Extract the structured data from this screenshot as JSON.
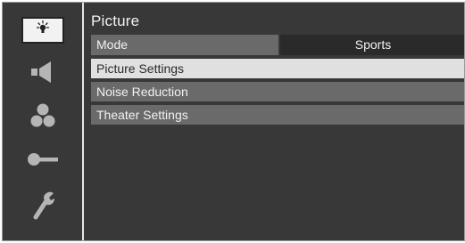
{
  "menu": {
    "title": "Picture",
    "mode": {
      "label": "Mode",
      "value": "Sports"
    },
    "items": [
      {
        "label": "Picture Settings",
        "selected": true
      },
      {
        "label": "Noise Reduction",
        "selected": false
      },
      {
        "label": "Theater Settings",
        "selected": false
      }
    ]
  },
  "sidebar": {
    "icons": [
      {
        "name": "picture-icon",
        "selected": true
      },
      {
        "name": "audio-speaker-icon",
        "selected": false
      },
      {
        "name": "channels-circles-icon",
        "selected": false
      },
      {
        "name": "lock-key-icon",
        "selected": false
      },
      {
        "name": "setup-wrench-icon",
        "selected": false
      }
    ]
  },
  "colors": {
    "background": "#383838",
    "bar": "#6a6a6a",
    "highlight": "#e0e0e0",
    "text": "#f2f2f2"
  }
}
